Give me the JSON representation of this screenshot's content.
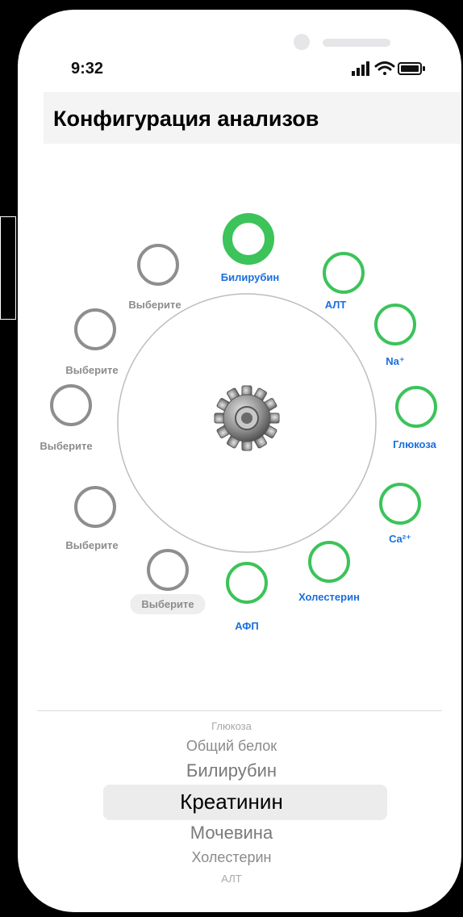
{
  "status_bar": {
    "time": "9:32",
    "icons": [
      "signal-icon",
      "wifi-icon",
      "battery-icon"
    ]
  },
  "header": {
    "title": "Конфигурация анализов"
  },
  "wheel": {
    "center_icon": "gear-icon",
    "slots": [
      {
        "label": "Билирубин",
        "state": "selected"
      },
      {
        "label": "АЛТ",
        "state": "set"
      },
      {
        "label": "Na⁺",
        "state": "set"
      },
      {
        "label": "Глюкоза",
        "state": "set"
      },
      {
        "label": "Ca²⁺",
        "state": "set"
      },
      {
        "label": "Холестерин",
        "state": "set"
      },
      {
        "label": "АФП",
        "state": "set"
      },
      {
        "label": "Выберите",
        "state": "empty-highlight"
      },
      {
        "label": "Выберите",
        "state": "empty"
      },
      {
        "label": "Выберите",
        "state": "empty"
      },
      {
        "label": "Выберите",
        "state": "empty"
      },
      {
        "label": "Выберите",
        "state": "empty"
      }
    ]
  },
  "picker": {
    "items": [
      "Глюкоза",
      "Общий белок",
      "Билирубин",
      "Креатинин",
      "Мочевина",
      "Холестерин",
      "АЛТ"
    ],
    "selected": "Креатинин"
  },
  "colors": {
    "set_ring": "#3cc35a",
    "empty_ring": "#8e8e8e",
    "set_label": "#1a6fe0",
    "empty_label": "#8c8c8c"
  }
}
